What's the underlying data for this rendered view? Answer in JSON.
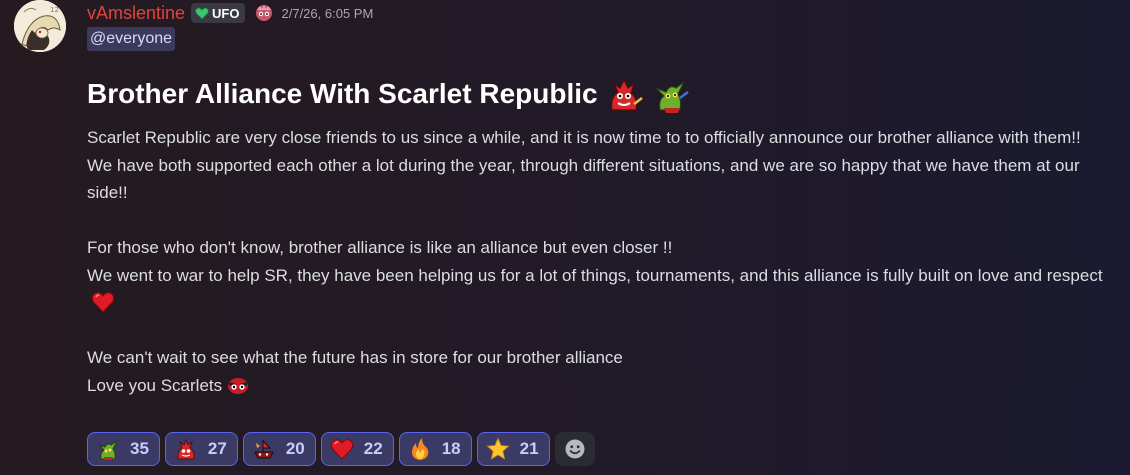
{
  "message": {
    "author": "vAmslentine",
    "tag": "UFO",
    "timestamp": "2/7/26, 6:05 PM",
    "mention": "@everyone",
    "title": "Brother Alliance With Scarlet Republic",
    "paragraphs": {
      "p1": "Scarlet Republic are very close friends to us since a while, and it is now time to to officially announce our brother alliance with them!!",
      "p2": "We have both supported each other a lot during the year, through different situations, and we are so happy that we have them at our side!!",
      "p3": "For those who don't know, brother alliance is like an alliance but even closer !!",
      "p4": "We went to war to help SR, they have been helping us for a lot of things, tournaments, and this alliance is fully built on love and respect",
      "p5": "We can't wait to see what the future has in store for our brother alliance",
      "p6": "Love you Scarlets"
    }
  },
  "reactions": [
    {
      "icon": "goblin-emoji",
      "count": "35"
    },
    {
      "icon": "scarlet-dragon-emoji",
      "count": "27"
    },
    {
      "icon": "scarlet-ship-emoji",
      "count": "20"
    },
    {
      "icon": "red-heart-emoji",
      "count": "22"
    },
    {
      "icon": "fire-emoji",
      "count": "18"
    },
    {
      "icon": "star-emoji",
      "count": "21"
    }
  ],
  "colors": {
    "username": "#e0443c",
    "accent": "#5865f2",
    "reaction_bg": "#3b3a64",
    "mention_bg": "#3c3a5c"
  }
}
